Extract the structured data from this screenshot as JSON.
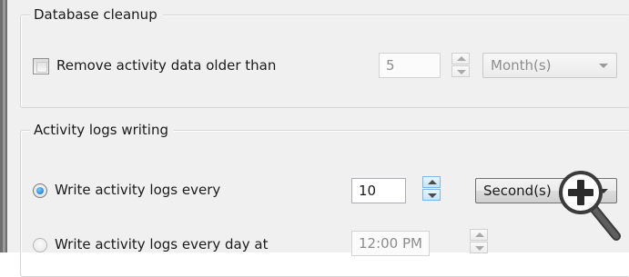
{
  "database_cleanup": {
    "group_title": "Database cleanup",
    "remove_checkbox_label": "Remove activity data older than",
    "remove_checked": false,
    "age_value": "5",
    "age_unit": "Month(s)"
  },
  "activity_logs": {
    "group_title": "Activity logs writing",
    "option_every_label": "Write activity logs every",
    "option_every_selected": true,
    "interval_value": "10",
    "interval_unit": "Second(s)",
    "option_daily_label": "Write activity logs every day at",
    "option_daily_selected": false,
    "daily_time": "12:00 PM"
  },
  "icons": {
    "zoom": "zoom-in-magnifier-icon"
  }
}
